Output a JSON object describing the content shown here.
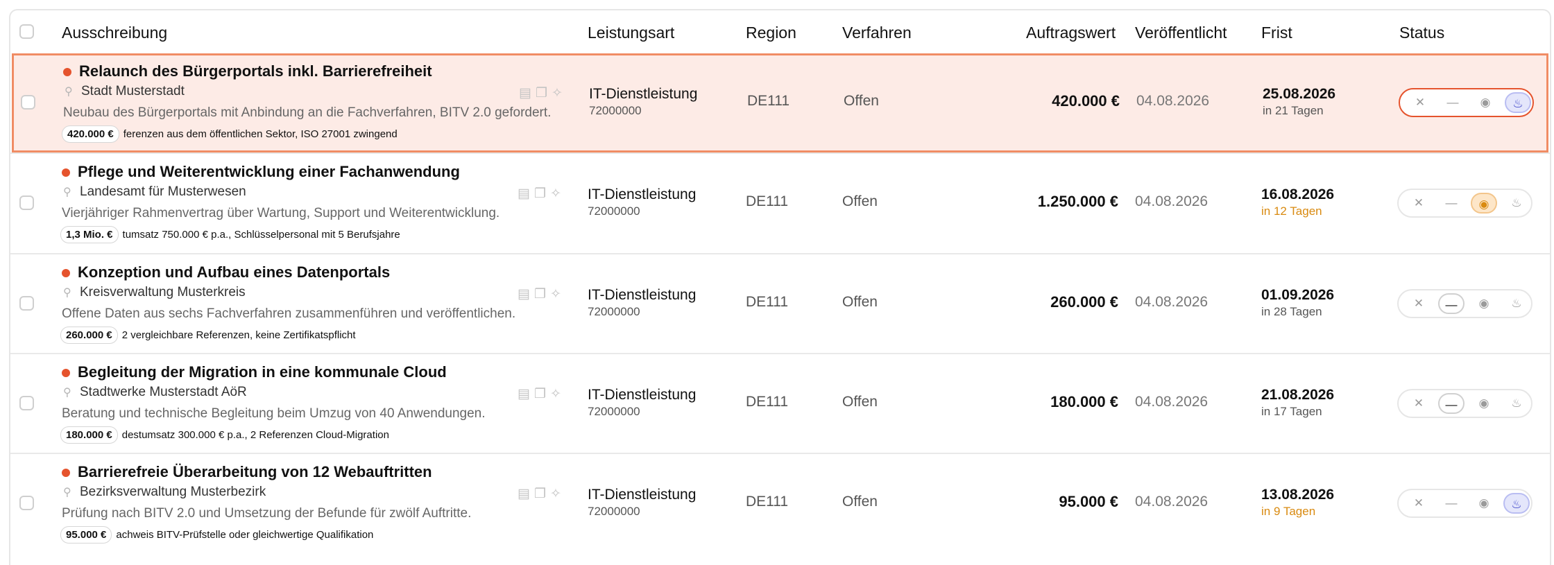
{
  "table": {
    "headers": {
      "tender": "Ausschreibung",
      "service_type": "Leistungsart",
      "region": "Region",
      "procedure": "Verfahren",
      "contract_value": "Auftragswert",
      "published": "Veröffentlicht",
      "deadline": "Frist",
      "status": "Status"
    },
    "rows": [
      {
        "title": "Relaunch des Bürgerportals inkl. Barrierefreiheit",
        "organization": "Stadt Musterstadt",
        "description": "Neubau des Bürgerportals mit Anbindung an die Fachverfahren, BITV 2.0 gefordert.",
        "value_badge": "420.000 €",
        "requirements": "ferenzen aus dem öffentlichen Sektor, ISO 27001 zwingend",
        "service_type": "IT-Dienstleistung",
        "cpv": "72000000",
        "region": "DE111",
        "procedure": "Offen",
        "contract_value": "420.000 €",
        "published": "04.08.2026",
        "deadline": "25.08.2026",
        "deadline_relative": "in 21 Tagen",
        "deadline_warn": false,
        "status": "hot",
        "highlighted": true
      },
      {
        "title": "Pflege und Weiterentwicklung einer Fachanwendung",
        "organization": "Landesamt für Musterwesen",
        "description": "Vierjähriger Rahmenvertrag über Wartung, Support und Weiterentwicklung.",
        "value_badge": "1,3 Mio. €",
        "requirements": "tumsatz 750.000 € p.a., Schlüsselpersonal mit 5 Berufsjahren",
        "service_type": "IT-Dienstleistung",
        "cpv": "72000000",
        "region": "DE111",
        "procedure": "Offen",
        "contract_value": "1.250.000 €",
        "published": "04.08.2026",
        "deadline": "16.08.2026",
        "deadline_relative": "in 12 Tagen",
        "deadline_warn": true,
        "status": "watch",
        "highlighted": false
      },
      {
        "title": "Konzeption und Aufbau eines Datenportals",
        "organization": "Kreisverwaltung Musterkreis",
        "description": "Offene Daten aus sechs Fachverfahren zusammenführen und veröffentlichen.",
        "value_badge": "260.000 €",
        "requirements": "2 vergleichbare Referenzen, keine Zertifikatspflicht",
        "service_type": "IT-Dienstleistung",
        "cpv": "72000000",
        "region": "DE111",
        "procedure": "Offen",
        "contract_value": "260.000 €",
        "published": "04.08.2026",
        "deadline": "01.09.2026",
        "deadline_relative": "in 28 Tagen",
        "deadline_warn": false,
        "status": "neutral",
        "highlighted": false
      },
      {
        "title": "Begleitung der Migration in eine kommunale Cloud",
        "organization": "Stadtwerke Musterstadt AöR",
        "description": "Beratung und technische Begleitung beim Umzug von 40 Anwendungen.",
        "value_badge": "180.000 €",
        "requirements": "destumsatz 300.000 € p.a., 2 Referenzen Cloud-Migration",
        "service_type": "IT-Dienstleistung",
        "cpv": "72000000",
        "region": "DE111",
        "procedure": "Offen",
        "contract_value": "180.000 €",
        "published": "04.08.2026",
        "deadline": "21.08.2026",
        "deadline_relative": "in 17 Tagen",
        "deadline_warn": false,
        "status": "neutral",
        "highlighted": false
      },
      {
        "title": "Barrierefreie Überarbeitung von 12 Webauftritten",
        "organization": "Bezirksverwaltung Musterbezirk",
        "description": "Prüfung nach BITV 2.0 und Umsetzung der Befunde für zwölf Auftritte.",
        "value_badge": "95.000 €",
        "requirements": "achweis BITV-Prüfstelle oder gleichwertige Qualifikation",
        "service_type": "IT-Dienstleistung",
        "cpv": "72000000",
        "region": "DE111",
        "procedure": "Offen",
        "contract_value": "95.000 €",
        "published": "04.08.2026",
        "deadline": "13.08.2026",
        "deadline_relative": "in 9 Tagen",
        "deadline_warn": true,
        "status": "hot",
        "highlighted": false
      }
    ]
  },
  "icons": {
    "pin": "pin-icon",
    "actions": [
      "document-icon",
      "copy-icon",
      "sparkle-icon"
    ],
    "status": [
      "close-icon",
      "dash-icon",
      "eye-icon",
      "flame-icon"
    ]
  },
  "colors": {
    "accent": "#e5532d",
    "highlight_bg": "#fdebe6",
    "warn": "#d98a10",
    "hot": "#3d44c9"
  }
}
